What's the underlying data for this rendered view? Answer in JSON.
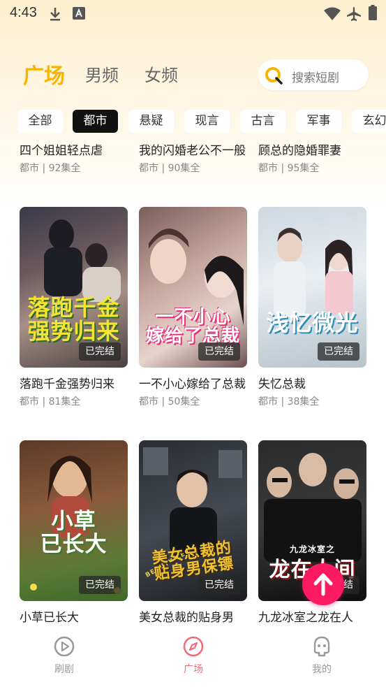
{
  "status_bar": {
    "time": "4:43"
  },
  "nav": {
    "tabs": [
      {
        "label": "广场"
      },
      {
        "label": "男频"
      },
      {
        "label": "女频"
      }
    ]
  },
  "search": {
    "placeholder": "搜索短剧"
  },
  "categories": [
    "全部",
    "都市",
    "悬疑",
    "现言",
    "古言",
    "军事",
    "玄幻"
  ],
  "selected_category": "都市",
  "rows": [
    {
      "items": [
        {
          "title": "四个姐姐轻点虐",
          "meta": "都市 | 92集全"
        },
        {
          "title": "我的闪婚老公不一般",
          "meta": "都市 | 90集全"
        },
        {
          "title": "顾总的隐婚罪妻",
          "meta": "都市 | 95集全"
        }
      ]
    },
    {
      "items": [
        {
          "title": "落跑千金强势归来",
          "meta": "都市 | 81集全",
          "badge": "已完结",
          "poster_text": "落跑千金\n强势归来"
        },
        {
          "title": "一不小心嫁给了总裁",
          "meta": "都市 | 50集全",
          "badge": "已完结",
          "poster_text": "一不小心\n嫁给了总裁"
        },
        {
          "title": "失忆总裁",
          "meta": "都市 | 38集全",
          "badge": "已完结",
          "poster_text": "浅忆微光"
        }
      ]
    },
    {
      "items": [
        {
          "title": "小草已长大",
          "badge": "已完结",
          "poster_text": "小草\n已长大"
        },
        {
          "title": "美女总裁的贴身男",
          "badge": "已完结",
          "poster_text": "美女总裁的\n贴身男保镖",
          "poster_tag": "BEAUTY CEO"
        },
        {
          "title": "九龙冰室之龙在人",
          "badge": "已完结",
          "poster_text": "龙在人间",
          "poster_tag": "九龙冰室之"
        }
      ]
    }
  ],
  "bottom_nav": [
    {
      "label": "刷剧",
      "icon": "play-circle-icon"
    },
    {
      "label": "广场",
      "icon": "compass-icon"
    },
    {
      "label": "我的",
      "icon": "profile-icon"
    }
  ],
  "colors": {
    "accent": "#f7b500",
    "active_nav": "#f26a7a",
    "fab": "#fc1b63"
  }
}
